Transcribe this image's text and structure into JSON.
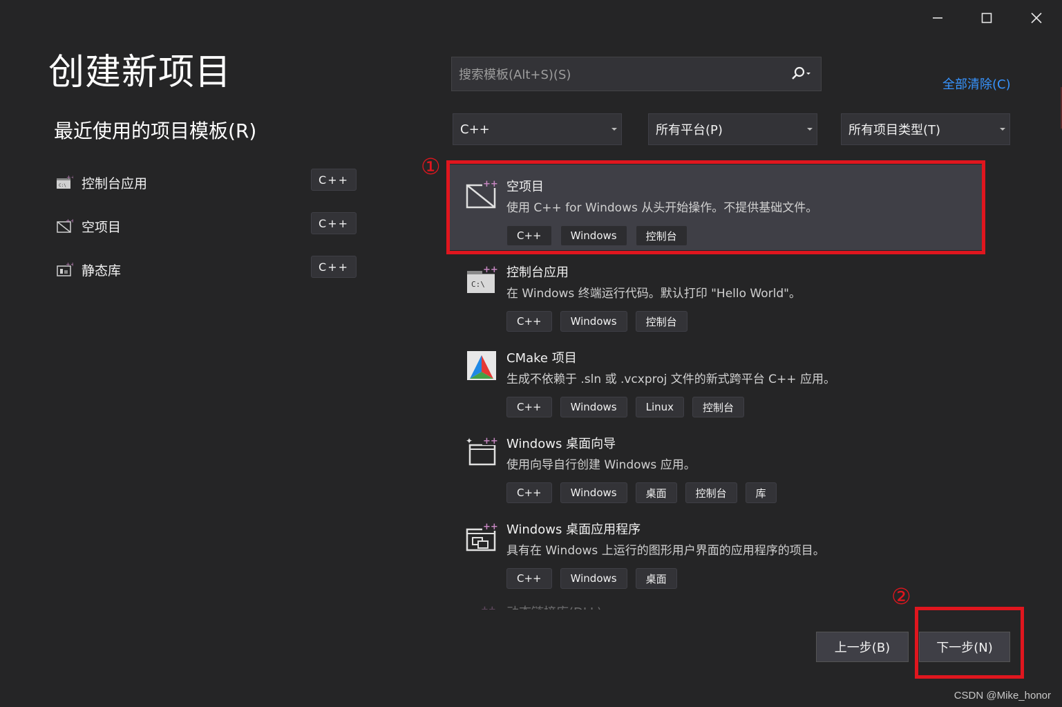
{
  "page": {
    "title": "创建新项目"
  },
  "recent": {
    "heading": "最近使用的项目模板(R)",
    "items": [
      {
        "label": "控制台应用",
        "tag": "C++",
        "icon": "console-app-icon"
      },
      {
        "label": "空项目",
        "tag": "C++",
        "icon": "empty-project-icon"
      },
      {
        "label": "静态库",
        "tag": "C++",
        "icon": "static-library-icon"
      }
    ]
  },
  "search": {
    "placeholder": "搜索模板(Alt+S)(S)",
    "clear_label": "全部清除(C)"
  },
  "filters": {
    "language": "C++",
    "platform": "所有平台(P)",
    "project_type": "所有项目类型(T)"
  },
  "templates": [
    {
      "name": "空项目",
      "description": "使用 C++ for Windows 从头开始操作。不提供基础文件。",
      "tags": [
        "C++",
        "Windows",
        "控制台"
      ],
      "icon": "empty-project-icon",
      "selected": true
    },
    {
      "name": "控制台应用",
      "description": "在 Windows 终端运行代码。默认打印 \"Hello World\"。",
      "tags": [
        "C++",
        "Windows",
        "控制台"
      ],
      "icon": "console-app-icon"
    },
    {
      "name": "CMake 项目",
      "description": "生成不依赖于 .sln 或 .vcxproj 文件的新式跨平台 C++ 应用。",
      "tags": [
        "C++",
        "Windows",
        "Linux",
        "控制台"
      ],
      "icon": "cmake-icon"
    },
    {
      "name": "Windows 桌面向导",
      "description": "使用向导自行创建 Windows 应用。",
      "tags": [
        "C++",
        "Windows",
        "桌面",
        "控制台",
        "库"
      ],
      "icon": "desktop-wizard-icon"
    },
    {
      "name": "Windows 桌面应用程序",
      "description": "具有在 Windows 上运行的图形用户界面的应用程序的项目。",
      "tags": [
        "C++",
        "Windows",
        "桌面"
      ],
      "icon": "desktop-app-icon"
    },
    {
      "name": "动态链接库(DLL)",
      "icon": "dll-icon"
    }
  ],
  "annotations": {
    "marker1": "①",
    "marker2": "②",
    "color": "#e0161e"
  },
  "buttons": {
    "back": "上一步(B)",
    "next": "下一步(N)"
  },
  "watermark": "CSDN @Mike_honor",
  "colors": {
    "background": "#252526",
    "accent_link": "#3794ff",
    "selected_row": "#3f3f46",
    "highlight": "#e0161e"
  }
}
